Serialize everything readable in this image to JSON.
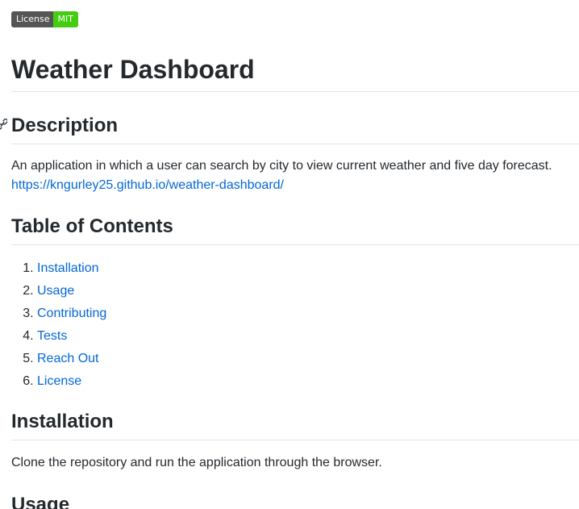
{
  "badge": {
    "label": "License",
    "value": "MIT",
    "label_color": "#555555",
    "value_color": "#44cc11"
  },
  "title": "Weather Dashboard",
  "description": {
    "heading": "Description",
    "text": "An application in which a user can search by city to view current weather and five day forecast.",
    "link": "https://kngurley25.github.io/weather-dashboard/",
    "anchor_icon": "link-icon"
  },
  "toc": {
    "heading": "Table of Contents",
    "items": [
      {
        "label": "Installation"
      },
      {
        "label": "Usage"
      },
      {
        "label": "Contributing"
      },
      {
        "label": "Tests"
      },
      {
        "label": "Reach Out"
      },
      {
        "label": "License"
      }
    ]
  },
  "installation": {
    "heading": "Installation",
    "text": "Clone the repository and run the application through the browser."
  },
  "usage": {
    "heading": "Usage"
  },
  "colors": {
    "link": "#0366d6",
    "text": "#24292e",
    "rule": "#e1e4e8"
  }
}
